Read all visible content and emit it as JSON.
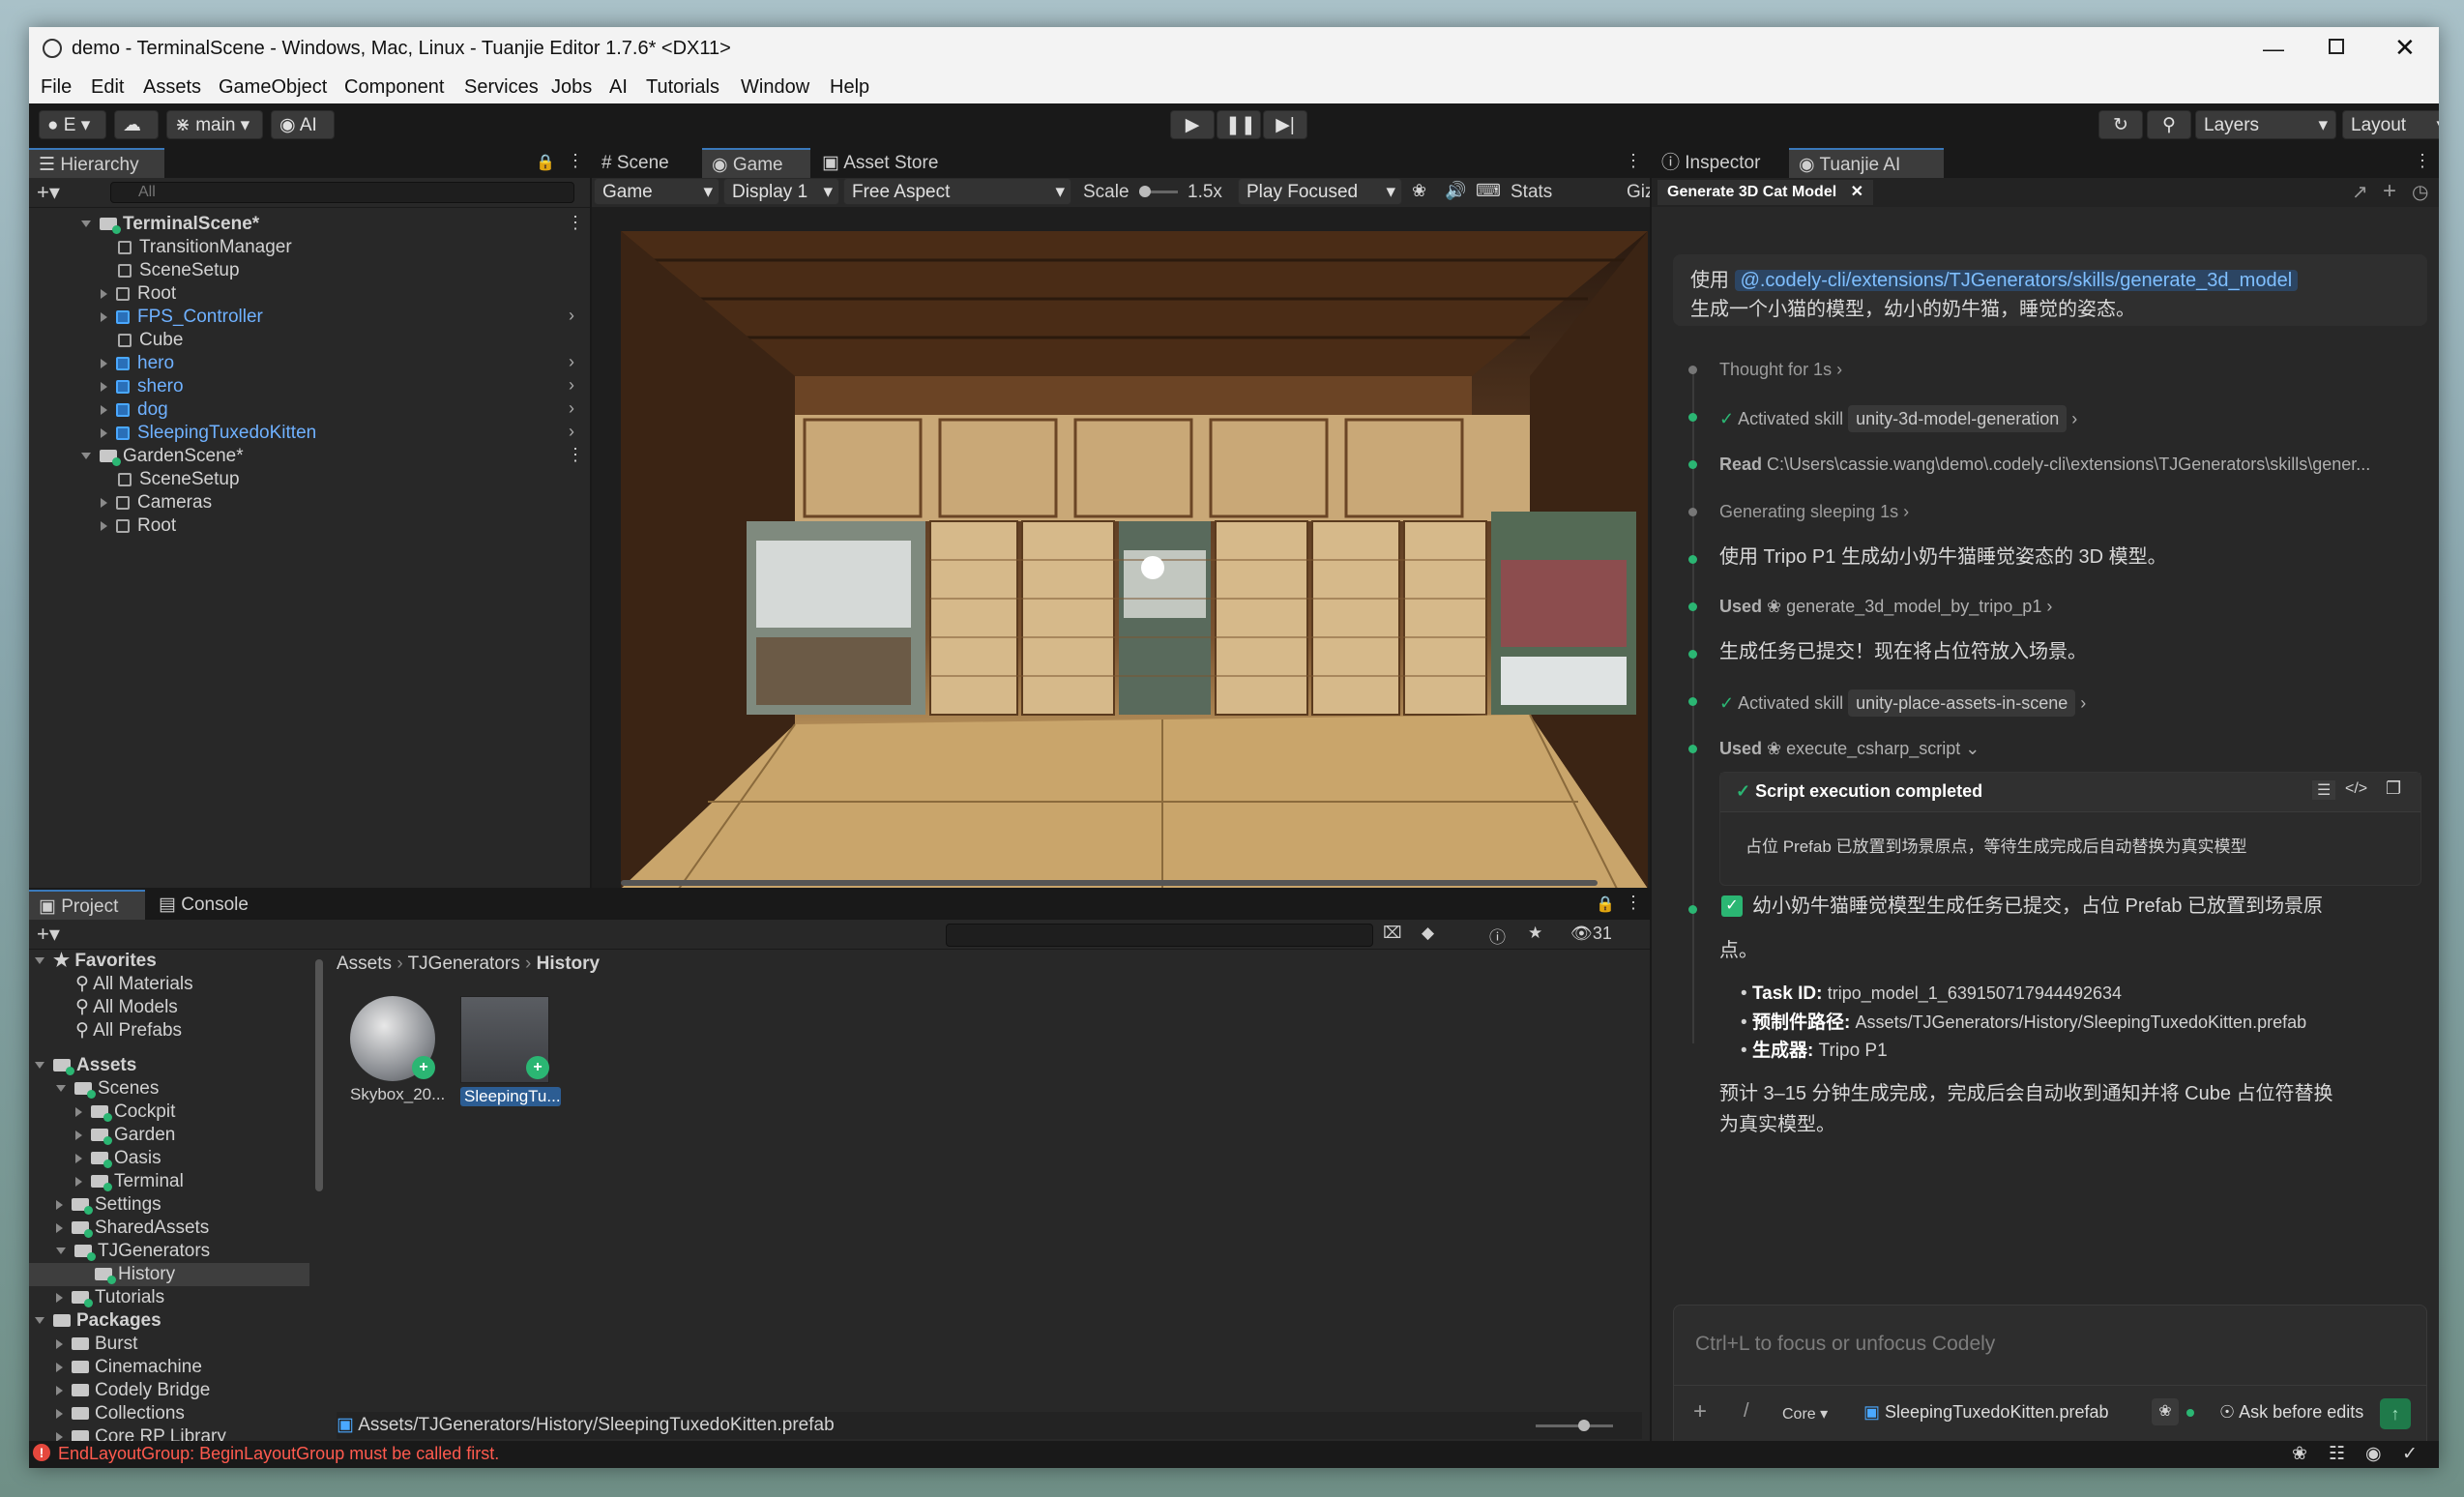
{
  "window": {
    "title": "demo - TerminalScene - Windows, Mac, Linux - Tuanjie Editor 1.7.6* <DX11>"
  },
  "menu": [
    "File",
    "Edit",
    "Assets",
    "GameObject",
    "Component",
    "Services",
    "Jobs",
    "AI",
    "Tutorials",
    "Window",
    "Help"
  ],
  "toolbar": {
    "account": "E",
    "branch": "main",
    "ai": "AI",
    "layers": "Layers",
    "layout": "Layout"
  },
  "hierarchy": {
    "tab": "Hierarchy",
    "search_placeholder": "All",
    "scene1": "TerminalScene*",
    "scene1_items": [
      "TransitionManager",
      "SceneSetup",
      "Root",
      "FPS_Controller",
      "Cube",
      "hero",
      "shero",
      "dog",
      "SleepingTuxedoKitten"
    ],
    "scene2": "GardenScene*",
    "scene2_items": [
      "SceneSetup",
      "Cameras",
      "Root"
    ]
  },
  "viewport": {
    "tabs": [
      "Scene",
      "Game",
      "Asset Store"
    ],
    "game_dropdown": "Game",
    "display": "Display 1",
    "aspect": "Free Aspect",
    "scale_label": "Scale",
    "scale_value": "1.5x",
    "play_mode": "Play Focused",
    "stats": "Stats",
    "gizmos": "Giz"
  },
  "project": {
    "tabs": [
      "Project",
      "Console"
    ],
    "count": "31",
    "favorites_label": "Favorites",
    "favorites": [
      "All Materials",
      "All Models",
      "All Prefabs"
    ],
    "assets_label": "Assets",
    "scenes_label": "Scenes",
    "scenes": [
      "Cockpit",
      "Garden",
      "Oasis",
      "Terminal"
    ],
    "settings": "Settings",
    "shared": "SharedAssets",
    "tjgen": "TJGenerators",
    "history": "History",
    "tutorials": "Tutorials",
    "packages_label": "Packages",
    "packages": [
      "Burst",
      "Cinemachine",
      "Codely Bridge",
      "Collections",
      "Core RP Library"
    ],
    "breadcrumb": [
      "Assets",
      "TJGenerators",
      "History"
    ],
    "assets": [
      "Skybox_20...",
      "SleepingTu..."
    ],
    "status_path": "Assets/TJGenerators/History/SleepingTuxedoKitten.prefab"
  },
  "ai_panel": {
    "tabs": [
      "Inspector",
      "Tuanjie AI"
    ],
    "session_tab": "Generate 3D Cat Model",
    "prompt_prefix": "使用",
    "prompt_link": "@.codely-cli/extensions/TJGenerators/skills/generate_3d_model",
    "prompt_text": "生成一个小猫的模型，幼小的奶牛猫，睡觉的姿态。",
    "thought": "Thought for 1s",
    "activated1_label": "Activated skill",
    "activated1_skill": "unity-3d-model-generation",
    "read_label": "Read",
    "read_path": "C:\\Users\\cassie.wang\\demo\\.codely-cli\\extensions\\TJGenerators\\skills\\gener...",
    "generating": "Generating sleeping 1s",
    "msg1": "使用 Tripo P1 生成幼小奶牛猫睡觉姿态的 3D 模型。",
    "used1_label": "Used",
    "used1_tool": "generate_3d_model_by_tripo_p1",
    "msg2": "生成任务已提交！现在将占位符放入场景。",
    "activated2_label": "Activated skill",
    "activated2_skill": "unity-place-assets-in-scene",
    "used2_label": "Used",
    "used2_tool": "execute_csharp_script",
    "script_status": "Script execution completed",
    "script_output": "占位 Prefab 已放置到场景原点，等待生成完成后自动替换为真实模型",
    "final_line1": "幼小奶牛猫睡觉模型生成任务已提交，占位 Prefab 已放置到场景原",
    "final_line2": "点。",
    "bullet1_key": "Task ID:",
    "bullet1_val": "tripo_model_1_639150717944492634",
    "bullet2_key": "预制件路径:",
    "bullet2_val": "Assets/TJGenerators/History/SleepingTuxedoKitten.prefab",
    "bullet3_key": "生成器:",
    "bullet3_val": "Tripo P1",
    "closing_line1": "预计 3–15 分钟生成完成，完成后会自动收到通知并将 Cube 占位符替换",
    "closing_line2": "为真实模型。",
    "input_placeholder": "Ctrl+L to focus or unfocus Codely",
    "mode": "Core",
    "attached_file": "SleepingTuxedoKitten.prefab",
    "approval": "Ask before edits"
  },
  "status_bar": {
    "error": "EndLayoutGroup: BeginLayoutGroup must be called first."
  },
  "colors": {
    "accent": "#3a79bb",
    "success": "#2bb673",
    "error": "#ff5a4e",
    "link": "#6fb1ff"
  }
}
